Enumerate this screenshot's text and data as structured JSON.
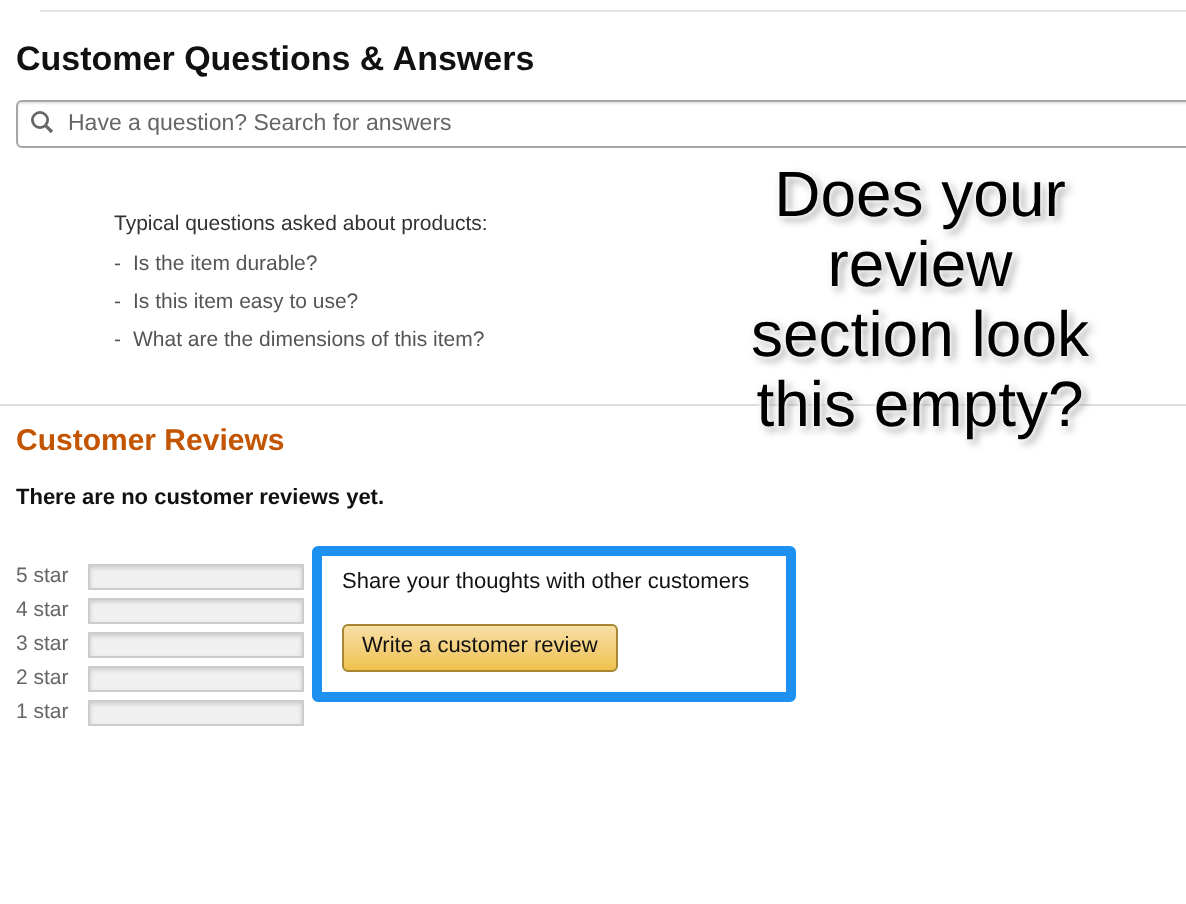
{
  "qa": {
    "title": "Customer Questions & Answers",
    "search": {
      "placeholder": "Have a question? Search for answers"
    },
    "typical_heading": "Typical questions asked about products:",
    "typical_questions": [
      {
        "bullet": "-",
        "text": "Is the item durable?"
      },
      {
        "bullet": "-",
        "text": "Is this item easy to use?"
      },
      {
        "bullet": "-",
        "text": "What are the dimensions of this item?"
      }
    ]
  },
  "reviews": {
    "title": "Customer Reviews",
    "empty_message": "There are no customer reviews yet.",
    "histogram": [
      {
        "label": "5 star",
        "level": 0
      },
      {
        "label": "4 star",
        "level": 0
      },
      {
        "label": "3 star",
        "level": 0
      },
      {
        "label": "2 star",
        "level": 0
      },
      {
        "label": "1 star",
        "level": 0
      }
    ],
    "share_prompt": "Share your thoughts with other customers",
    "write_button": "Write a customer review"
  },
  "overlay_caption": [
    "Does your",
    "review",
    "section look",
    "this empty?"
  ]
}
